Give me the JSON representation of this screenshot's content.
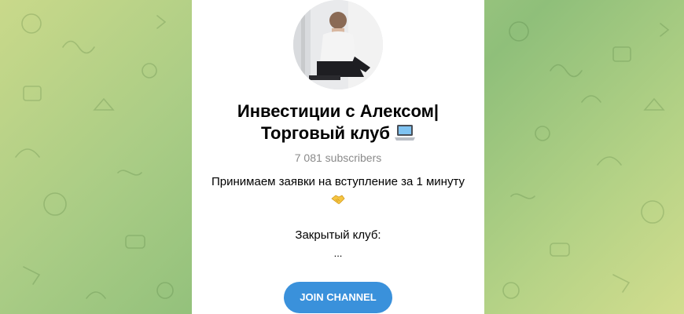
{
  "channel": {
    "title_line1": "Инвестиции с Алексом|",
    "title_line2": "Торговый клуб",
    "title_emoji_icon": "laptop-icon",
    "subscribers": "7 081 subscribers",
    "description": "Принимаем заявки на вступление за 1 минуту",
    "description_emoji_icon": "handshake-icon",
    "closed_club": "Закрытый клуб:",
    "ellipsis": "..."
  },
  "actions": {
    "join_label": "JOIN CHANNEL"
  },
  "colors": {
    "accent": "#3a91db",
    "muted_text": "#8a8a8a",
    "card_bg": "#ffffff"
  }
}
